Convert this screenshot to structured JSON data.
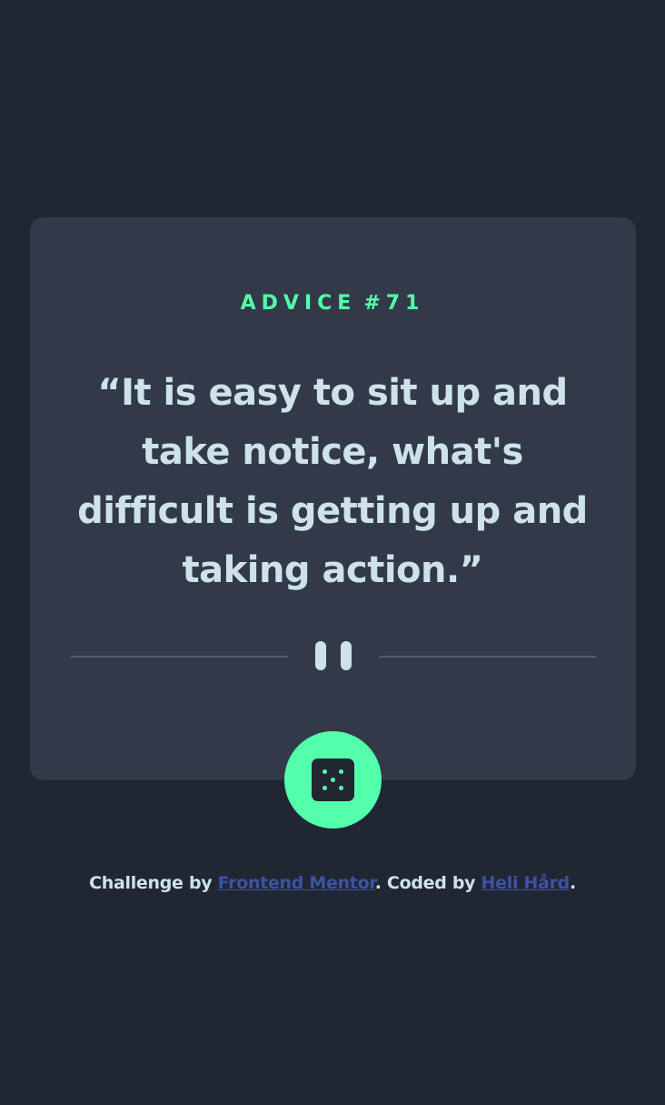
{
  "advice": {
    "label": "ADVICE",
    "number": "#71",
    "quote": "“It is easy to sit up and take notice, what's difficult is getting up and taking action.”"
  },
  "icons": {
    "divider": "pause-icon",
    "button": "dice-icon"
  },
  "attribution": {
    "challenge_prefix": "Challenge by ",
    "challenge_link": "Frontend Mentor",
    "coded_prefix": ". Coded by ",
    "coded_link": "Heli Hård",
    "suffix": "."
  },
  "colors": {
    "background": "#202632",
    "card": "#323a49",
    "accent": "#53ffaa",
    "text": "#cee3e9",
    "divider": "#4f5d74",
    "link": "#3e52a3"
  }
}
